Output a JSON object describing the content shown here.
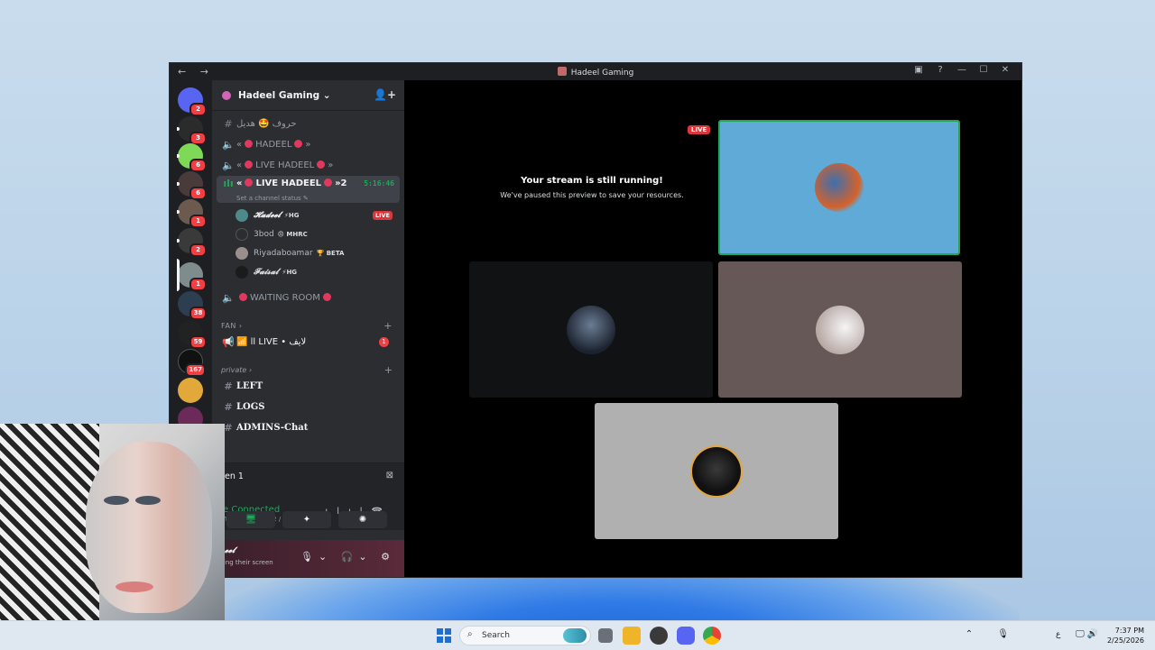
{
  "window": {
    "title": "Hadeel Gaming",
    "nav_arrows": "← →",
    "icons": [
      "screen-share-icon",
      "help-icon",
      "minimize-icon",
      "maximize-icon",
      "close-icon"
    ],
    "icon_glyphs": [
      "▣",
      "?",
      "—",
      "☐",
      "✕"
    ]
  },
  "server_rail": {
    "badges": [
      "2",
      "3",
      "6",
      "6",
      "1",
      "2",
      "1",
      "38",
      "59",
      "167"
    ]
  },
  "server": {
    "name": "Hadeel Gaming ⌄",
    "add_member_icon": "👤+"
  },
  "channels": {
    "c1": "حروف 🤩 هديل",
    "c2_left": "«",
    "c2_name": "HADEEL",
    "c2_right": "»",
    "c3_left": "«",
    "c3_name": "LIVE HADEEL",
    "c3_right": "»",
    "active_left": "«",
    "active_name": "LIVE HADEEL",
    "active_right": "»2",
    "active_status": "Set a channel status ✎",
    "active_timer": "5:16:46",
    "waiting": "WAITING ROOM"
  },
  "voice_users": [
    {
      "name": "𝓗𝓪𝓭𝓮𝓮𝓵",
      "tag": "⚡HG",
      "live": "LIVE"
    },
    {
      "name": "3bod",
      "tag": "😠 MHRC",
      "live": ""
    },
    {
      "name": "Riyadaboamar",
      "tag": "🏆 BETA",
      "live": ""
    },
    {
      "name": "𝓕𝓪𝓲𝓼𝓪𝓵",
      "tag": "⚡HG",
      "live": ""
    }
  ],
  "categories": {
    "fan": "FAN",
    "fan_arrow": "›",
    "fan_channel": "📶 اا LIVE • لايف",
    "fan_unread": "1",
    "private": "private",
    "private_arrow": "›",
    "left": "LEFT",
    "logs": "LOGS",
    "admins": "ADMINS-Chat",
    "plus": "+"
  },
  "voice_panel": {
    "title": "en 1",
    "connected": "e Connected",
    "location": "IVE HADEEL 🔴 »2 / Hadeel Gaming",
    "btn_screen": "🖥",
    "btn_activities": "✦",
    "btn_soundboard": "✺"
  },
  "user_panel": {
    "name": "𝓮𝓮𝓵",
    "status": "ring their screen",
    "icons": "🎙⌄ 🎧⌄ ⚙"
  },
  "stage": {
    "live_tag": "LIVE",
    "paused_title": "Your stream is still running!",
    "paused_sub": "We've paused this preview to save your resources."
  },
  "taskbar": {
    "search_placeholder": "Search",
    "tray_glyphs": "⌃ 🎙",
    "lang": "ع",
    "time": "7:37 PM",
    "date": "2/25/2026"
  },
  "colors": {
    "accent_live": "#da373c",
    "connected_green": "#23a55a",
    "speaking_border": "#23a55a",
    "tile_blue": "#5faad6",
    "tile_dark": "#111214",
    "tile_brown": "#655856",
    "tile_grey": "#b0b0b0"
  }
}
